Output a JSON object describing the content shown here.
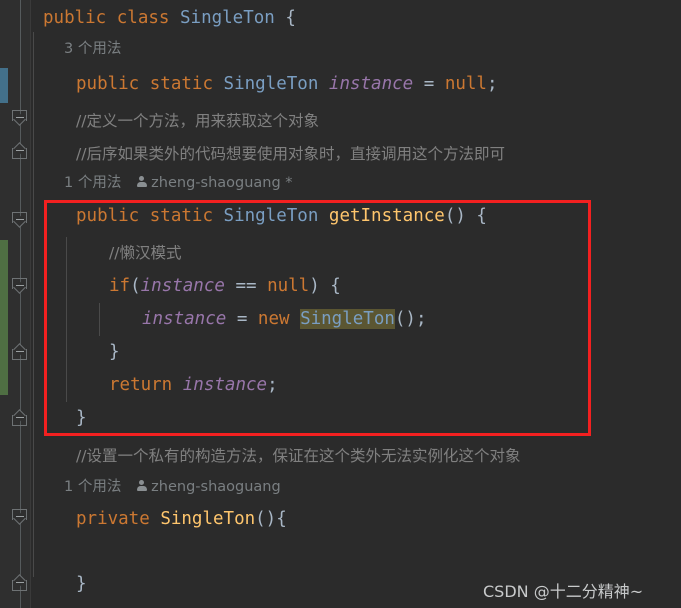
{
  "editor": {
    "theme_name": "darcula",
    "background": "#2b2b2b",
    "gutter_background": "#2f2f2f",
    "colors": {
      "keyword": "#cc7832",
      "class_name": "#7a9ec2",
      "field": "#9876aa",
      "method": "#ffc66d",
      "comment": "#808080",
      "default_text": "#a9b7c6",
      "inlay_hint": "#7a7f82",
      "highlight": "#5b5632",
      "annotation_box": "#f32020",
      "change_bar_modified": "#43708a",
      "change_bar_added": "#4f6f43"
    },
    "lines": [
      {
        "id": "line-class-decl",
        "indent": 0,
        "tokens": [
          {
            "t": "public",
            "c": "kw"
          },
          {
            "t": " ",
            "c": "punc"
          },
          {
            "t": "class",
            "c": "kw"
          },
          {
            "t": " ",
            "c": "punc"
          },
          {
            "t": "SingleTon",
            "c": "type"
          },
          {
            "t": " {",
            "c": "punc"
          }
        ]
      },
      {
        "id": "line-field-decl",
        "indent": 1,
        "tokens": [
          {
            "t": "public",
            "c": "kw"
          },
          {
            "t": " ",
            "c": "punc"
          },
          {
            "t": "static",
            "c": "kw"
          },
          {
            "t": " ",
            "c": "punc"
          },
          {
            "t": "SingleTon",
            "c": "type"
          },
          {
            "t": " ",
            "c": "punc"
          },
          {
            "t": "instance",
            "c": "field"
          },
          {
            "t": " = ",
            "c": "punc"
          },
          {
            "t": "null",
            "c": "kw"
          },
          {
            "t": ";",
            "c": "punc"
          }
        ]
      },
      {
        "id": "line-comment-define",
        "indent": 1,
        "tokens": [
          {
            "t": "//定义一个方法，用来获取这个对象",
            "c": "com"
          }
        ]
      },
      {
        "id": "line-comment-later",
        "indent": 1,
        "tokens": [
          {
            "t": "//后序如果类外的代码想要使用对象时，直接调用这个方法即可",
            "c": "com"
          }
        ]
      },
      {
        "id": "line-getinstance-signature",
        "indent": 1,
        "tokens": [
          {
            "t": "public",
            "c": "kw"
          },
          {
            "t": " ",
            "c": "punc"
          },
          {
            "t": "static",
            "c": "kw"
          },
          {
            "t": " ",
            "c": "punc"
          },
          {
            "t": "SingleTon",
            "c": "type"
          },
          {
            "t": " ",
            "c": "punc"
          },
          {
            "t": "getInstance",
            "c": "meth"
          },
          {
            "t": "() {",
            "c": "punc"
          }
        ]
      },
      {
        "id": "line-comment-lazy",
        "indent": 2,
        "tokens": [
          {
            "t": "//懒汉模式",
            "c": "com"
          }
        ]
      },
      {
        "id": "line-if-null",
        "indent": 2,
        "tokens": [
          {
            "t": "if",
            "c": "kw"
          },
          {
            "t": "(",
            "c": "punc"
          },
          {
            "t": "instance",
            "c": "field"
          },
          {
            "t": " == ",
            "c": "punc"
          },
          {
            "t": "null",
            "c": "kw"
          },
          {
            "t": ") {",
            "c": "punc"
          }
        ]
      },
      {
        "id": "line-new-instance",
        "indent": 3,
        "tokens": [
          {
            "t": "instance",
            "c": "field"
          },
          {
            "t": " = ",
            "c": "punc"
          },
          {
            "t": "new",
            "c": "kw"
          },
          {
            "t": " ",
            "c": "punc"
          },
          {
            "t": "SingleTon",
            "c": "type hl"
          },
          {
            "t": "();",
            "c": "punc"
          }
        ]
      },
      {
        "id": "line-close-if",
        "indent": 2,
        "tokens": [
          {
            "t": "}",
            "c": "punc"
          }
        ]
      },
      {
        "id": "line-return-instance",
        "indent": 2,
        "tokens": [
          {
            "t": "return",
            "c": "kw"
          },
          {
            "t": " ",
            "c": "punc"
          },
          {
            "t": "instance",
            "c": "field"
          },
          {
            "t": ";",
            "c": "punc"
          }
        ]
      },
      {
        "id": "line-close-getinstance",
        "indent": 1,
        "tokens": [
          {
            "t": "}",
            "c": "punc"
          }
        ]
      },
      {
        "id": "line-comment-private-ctor",
        "indent": 1,
        "tokens": [
          {
            "t": "//设置一个私有的构造方法，保证在这个类外无法实例化这个对象",
            "c": "com"
          }
        ]
      },
      {
        "id": "line-ctor",
        "indent": 1,
        "tokens": [
          {
            "t": "private",
            "c": "kw"
          },
          {
            "t": " ",
            "c": "punc"
          },
          {
            "t": "SingleTon",
            "c": "meth"
          },
          {
            "t": "(){",
            "c": "punc"
          }
        ]
      },
      {
        "id": "line-close-ctor",
        "indent": 1,
        "tokens": [
          {
            "t": "}",
            "c": "punc"
          }
        ]
      }
    ],
    "inlay_hints": [
      {
        "id": "hint-class-usages",
        "usages": "3 个用法",
        "author": ""
      },
      {
        "id": "hint-getinstance-usages",
        "usages": "1 个用法",
        "author": "zheng-shaoguang *"
      },
      {
        "id": "hint-ctor-usages",
        "usages": "1 个用法",
        "author": "zheng-shaoguang"
      }
    ],
    "gutter": {
      "fold_markers": [
        {
          "id": "fold-marker-1",
          "direction": "down"
        },
        {
          "id": "fold-marker-2",
          "direction": "up"
        },
        {
          "id": "fold-marker-3",
          "direction": "down"
        },
        {
          "id": "fold-marker-4",
          "direction": "down"
        },
        {
          "id": "fold-marker-5",
          "direction": "up"
        },
        {
          "id": "fold-marker-6",
          "direction": "up"
        },
        {
          "id": "fold-marker-7",
          "direction": "down"
        },
        {
          "id": "fold-marker-8",
          "direction": "up"
        }
      ],
      "change_bars": [
        {
          "id": "change-bar-modified",
          "kind": "modified"
        },
        {
          "id": "change-bar-added",
          "kind": "added"
        }
      ]
    }
  },
  "annotation": {
    "id": "red-highlight-box",
    "label": "getInstance method highlight"
  },
  "watermark": {
    "text": "CSDN @十二分精神~"
  }
}
